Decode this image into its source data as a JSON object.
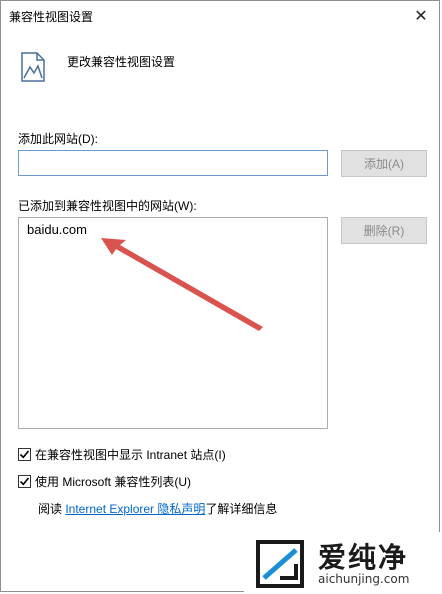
{
  "window": {
    "title": "兼容性视图设置",
    "close_glyph": "✕"
  },
  "header": {
    "text": "更改兼容性视图设置",
    "icon": "compat-view-icon"
  },
  "add_site": {
    "label": "添加此网站(D):",
    "input_value": "",
    "add_button": "添加(A)"
  },
  "site_list": {
    "label": "已添加到兼容性视图中的网站(W):",
    "items": [
      "baidu.com"
    ],
    "remove_button": "删除(R)"
  },
  "options": {
    "intranet": {
      "label": "在兼容性视图中显示 Intranet 站点(I)",
      "checked": true
    },
    "ms_list": {
      "label": "使用 Microsoft 兼容性列表(U)",
      "checked": true
    }
  },
  "info": {
    "prefix": "阅读 ",
    "link": "Internet Explorer 隐私声明",
    "suffix": "了解详细信息"
  },
  "watermark": {
    "text": "爱纯净",
    "url": "aichunjing.com"
  },
  "colors": {
    "arrow": "#d9534f",
    "link": "#0066cc"
  }
}
